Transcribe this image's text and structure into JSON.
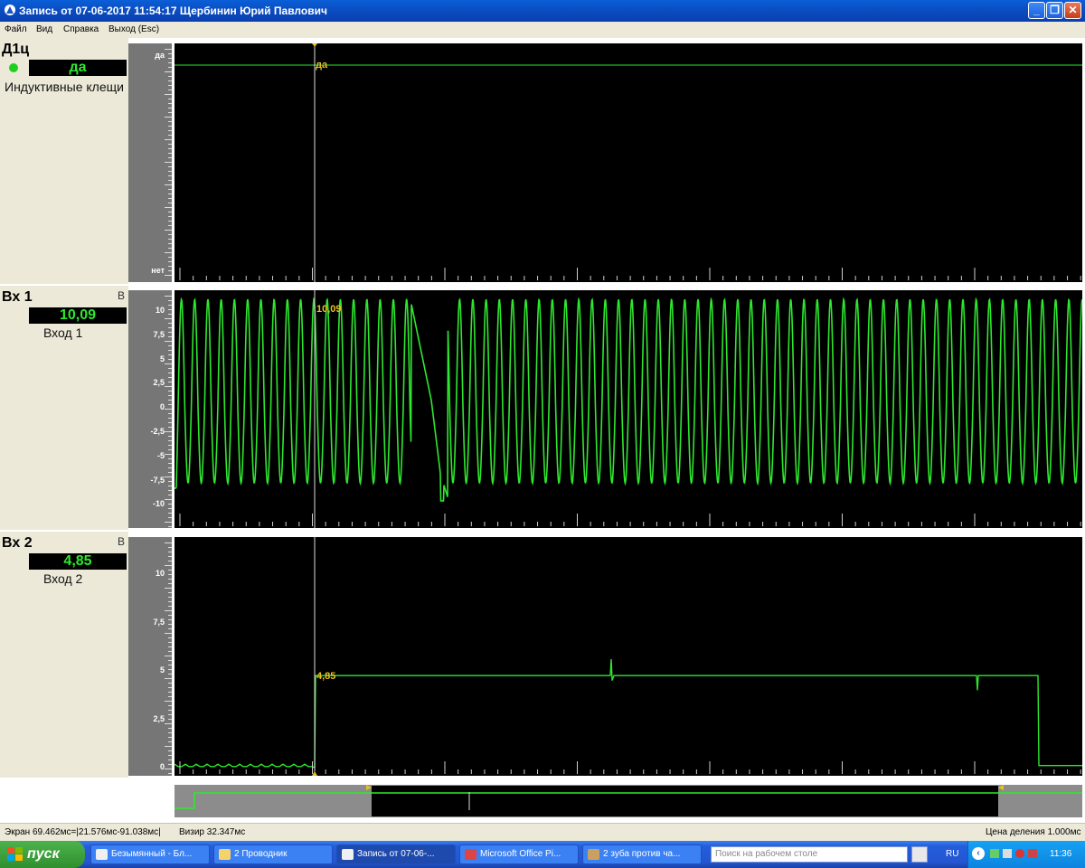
{
  "window": {
    "title": "Запись от 07-06-2017 11:54:17 Щербинин Юрий Павлович"
  },
  "menu": {
    "file": "Файл",
    "view": "Вид",
    "help": "Справка",
    "exit": "Выход (Esc)"
  },
  "channels": {
    "d1": {
      "name": "Д1ц",
      "value": "да",
      "desc": "Индуктивные клещи",
      "axis_top": "да",
      "axis_bottom": "нет",
      "cursor_value": "да",
      "status_color": "#1ED01E",
      "trace_color": "#2EE82E"
    },
    "in1": {
      "name": "Вх 1",
      "unit": "В",
      "value": "10,09",
      "desc": "Вход 1",
      "cursor_value": "10,09",
      "axis_ticks": [
        "10",
        "7,5",
        "5",
        "2,5",
        "0",
        "-2,5",
        "-5",
        "-7,5",
        "-10"
      ],
      "trace_color": "#2EE82E"
    },
    "in2": {
      "name": "Вх 2",
      "unit": "В",
      "value": "4,85",
      "desc": "Вход 2",
      "cursor_value": "4,85",
      "axis_ticks": [
        "10",
        "7,5",
        "5",
        "2,5",
        "0"
      ],
      "trace_color": "#2EE82E"
    }
  },
  "status": {
    "screen": "Экран 69.462мс=|21.576мс-91.038мс|",
    "visor": "Визир 32.347мс",
    "division": "Цена деления 1.000мс"
  },
  "taskbar": {
    "start": "пуск",
    "items": [
      "Безымянный - Бл...",
      "2 Проводник",
      "Запись от 07-06-...",
      "Microsoft Office Pi...",
      "2 зуба против ча..."
    ],
    "search_placeholder": "Поиск на рабочем столе",
    "lang": "RU",
    "clock": "11:36"
  }
}
